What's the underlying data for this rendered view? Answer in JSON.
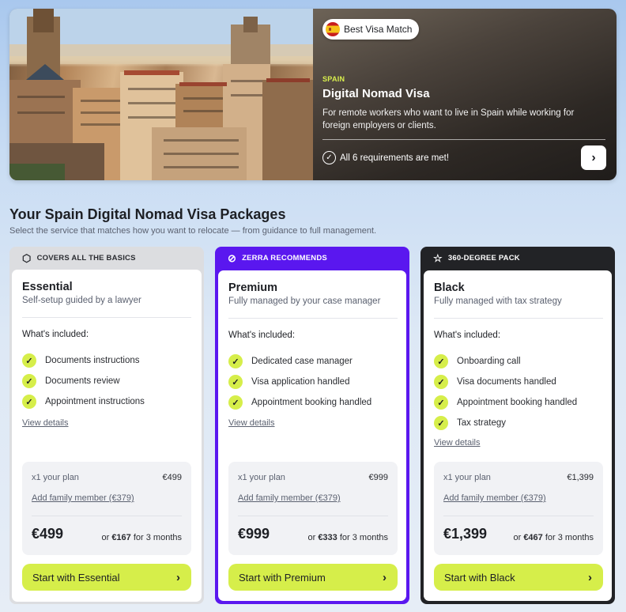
{
  "hero": {
    "badge": "Best Visa Match",
    "country": "SPAIN",
    "title": "Digital Nomad Visa",
    "description": "For remote workers who want to live in Spain while working for foreign employers or clients.",
    "requirements": "All 6 requirements are met!"
  },
  "section": {
    "title": "Your Spain Digital Nomad Visa Packages",
    "subtitle": "Select the service that matches how you want to relocate — from guidance to full management."
  },
  "packages": [
    {
      "ribbon": "COVERS ALL THE BASICS",
      "ribbon_icon": "box-icon",
      "name": "Essential",
      "tagline": "Self-setup guided by a lawyer",
      "included_label": "What's included:",
      "features": [
        "Documents instructions",
        "Documents review",
        "Appointment instructions"
      ],
      "view_details": "View details",
      "plan_label": "x1 your plan",
      "plan_price": "€499",
      "family": "Add family member (€379)",
      "total": "€499",
      "install_prefix": "or ",
      "install_amount": "€167",
      "install_suffix": " for 3 months",
      "cta": "Start with Essential"
    },
    {
      "ribbon": "ZERRA RECOMMENDS",
      "ribbon_icon": "discount-badge-icon",
      "name": "Premium",
      "tagline": "Fully managed by your case manager",
      "included_label": "What's included:",
      "features": [
        "Dedicated case manager",
        "Visa application handled",
        "Appointment booking handled"
      ],
      "view_details": "View details",
      "plan_label": "x1 your plan",
      "plan_price": "€999",
      "family": "Add family member (€379)",
      "total": "€999",
      "install_prefix": "or ",
      "install_amount": "€333",
      "install_suffix": " for 3 months",
      "cta": "Start with Premium"
    },
    {
      "ribbon": "360-DEGREE PACK",
      "ribbon_icon": "star-icon",
      "name": "Black",
      "tagline": "Fully managed with tax strategy",
      "included_label": "What's included:",
      "features": [
        "Onboarding call",
        "Visa documents handled",
        "Appointment booking handled",
        "Tax strategy"
      ],
      "view_details": "View details",
      "plan_label": "x1 your plan",
      "plan_price": "€1,399",
      "family": "Add family member (€379)",
      "total": "€1,399",
      "install_prefix": "or ",
      "install_amount": "€467",
      "install_suffix": " for 3 months",
      "cta": "Start with Black"
    }
  ],
  "colors": {
    "accent_lime": "#d6ee4a",
    "premium_purple": "#5a17ef",
    "black_card": "#222326"
  }
}
